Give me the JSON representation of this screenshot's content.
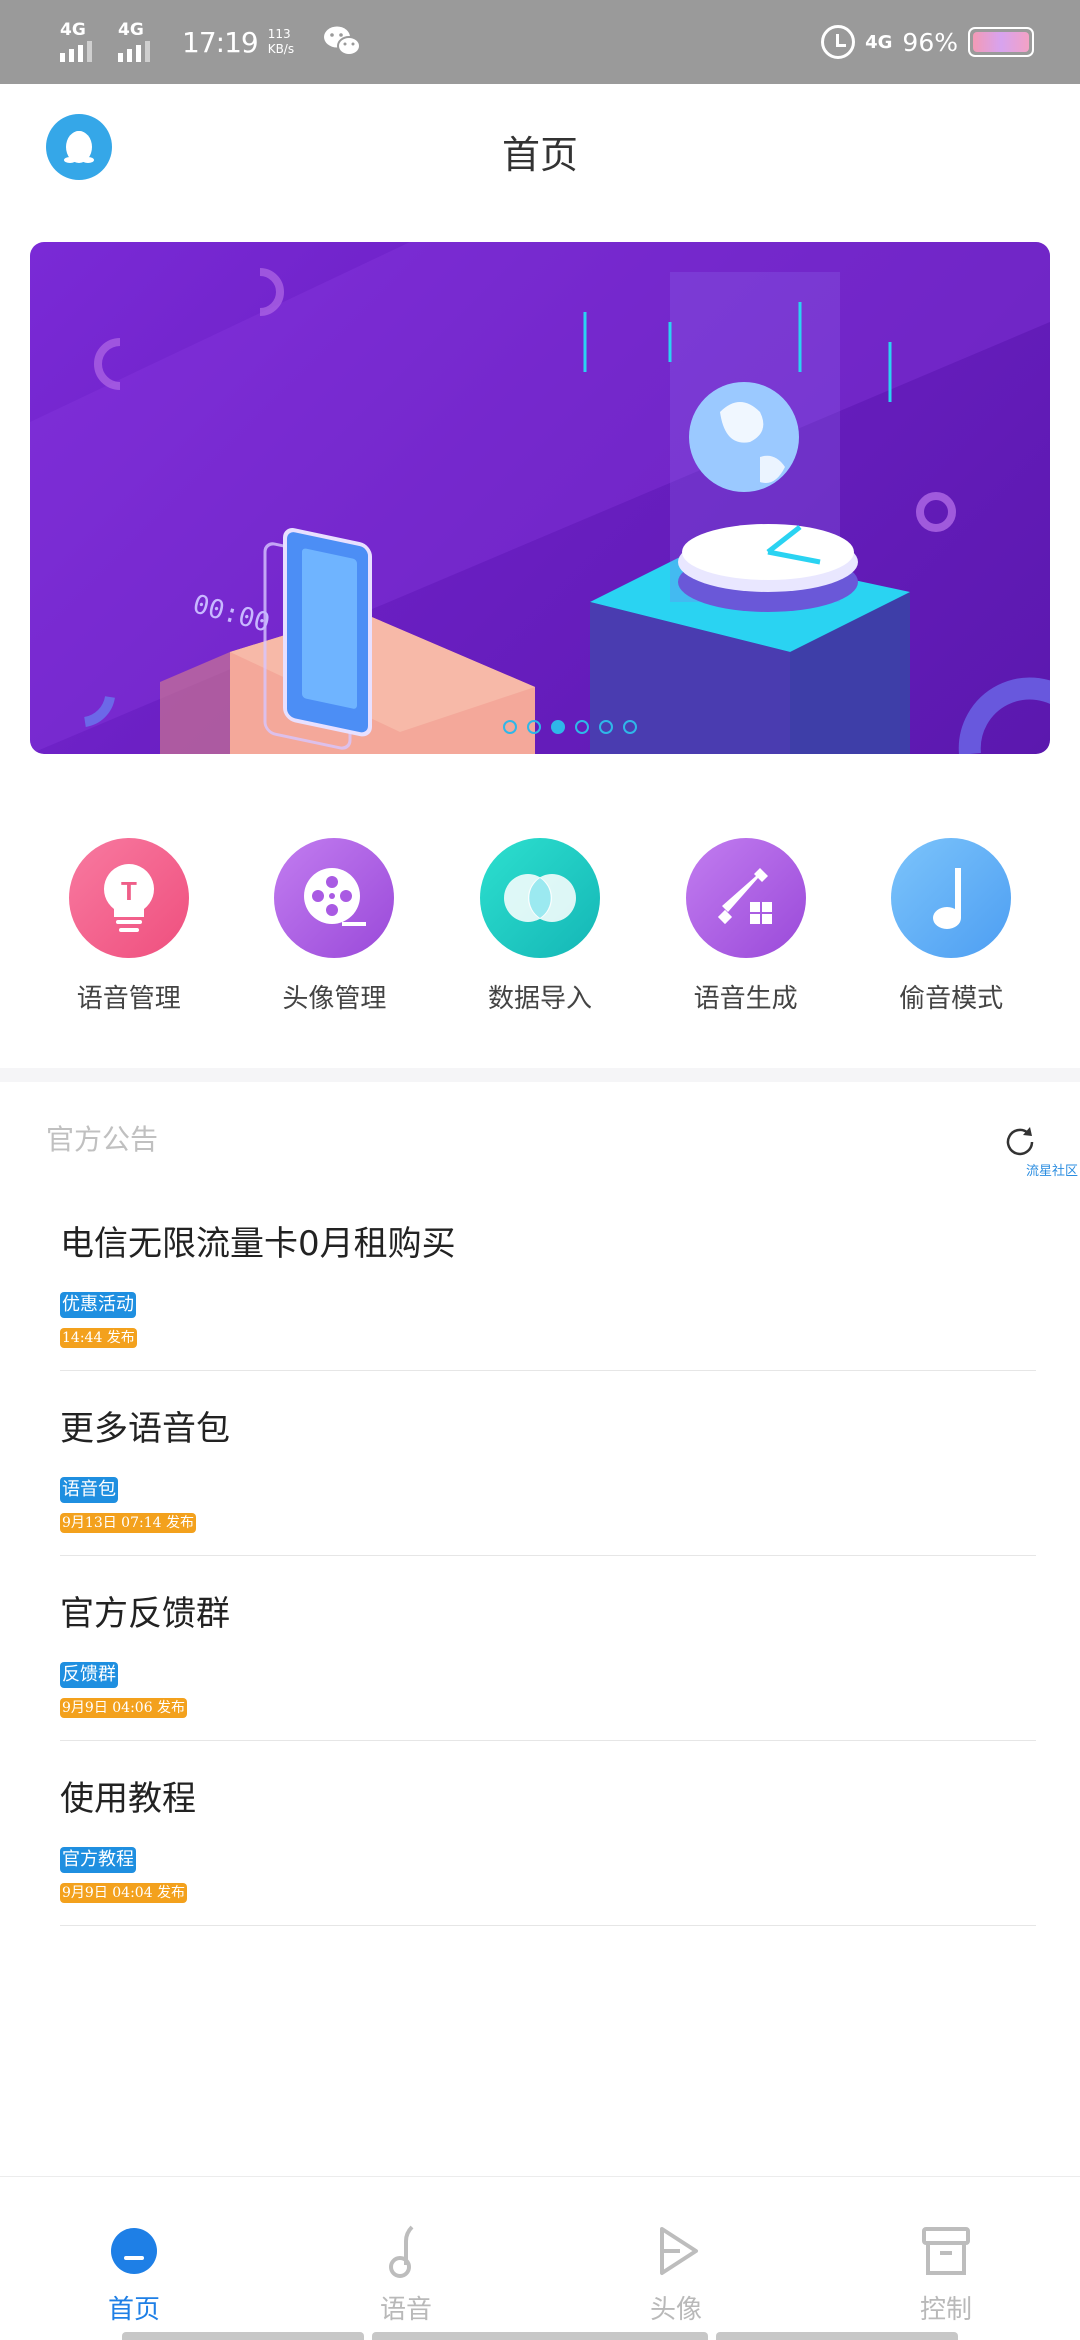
{
  "status_bar": {
    "sim1": "4G",
    "sim2": "4G",
    "time": "17:19",
    "speed_value": "113",
    "speed_unit": "KB/s",
    "network": "4G",
    "battery": "96%"
  },
  "header": {
    "title": "首页"
  },
  "banner": {
    "slide_count": 6,
    "active_slide": 3
  },
  "actions": [
    {
      "label": "语音管理",
      "icon": "lightbulb-icon",
      "color_from": "#f87aa0",
      "color_to": "#ef4f7e"
    },
    {
      "label": "头像管理",
      "icon": "film-reel-icon",
      "color_from": "#c27df0",
      "color_to": "#9a49d9"
    },
    {
      "label": "数据导入",
      "icon": "overlap-circles-icon",
      "color_from": "#2de0cf",
      "color_to": "#14b6b6"
    },
    {
      "label": "语音生成",
      "icon": "tools-icon",
      "color_from": "#c27df0",
      "color_to": "#9a49d9"
    },
    {
      "label": "偷音模式",
      "icon": "music-note-icon",
      "color_from": "#7cc4fb",
      "color_to": "#4d9ef2"
    }
  ],
  "notices": {
    "heading": "官方公告",
    "community_link": "流星社区",
    "items": [
      {
        "title": "电信无限流量卡0月租购买",
        "tag": "优惠活动",
        "time": "14:44 发布"
      },
      {
        "title": "更多语音包",
        "tag": "语音包",
        "time": "9月13日 07:14 发布"
      },
      {
        "title": "官方反馈群",
        "tag": "反馈群",
        "time": "9月9日 04:06 发布"
      },
      {
        "title": "使用教程",
        "tag": "官方教程",
        "time": "9月9日 04:04 发布"
      }
    ]
  },
  "bottom_nav": [
    {
      "label": "首页",
      "icon": "home-icon",
      "active": true
    },
    {
      "label": "语音",
      "icon": "music-note-icon",
      "active": false
    },
    {
      "label": "头像",
      "icon": "play-icon",
      "active": false
    },
    {
      "label": "控制",
      "icon": "archive-icon",
      "active": false
    }
  ],
  "colors": {
    "accent": "#1e7fe6",
    "tag_blue": "#1f8fe0",
    "time_orange": "#f3a11d",
    "banner_purple": "#6a1fc2"
  }
}
